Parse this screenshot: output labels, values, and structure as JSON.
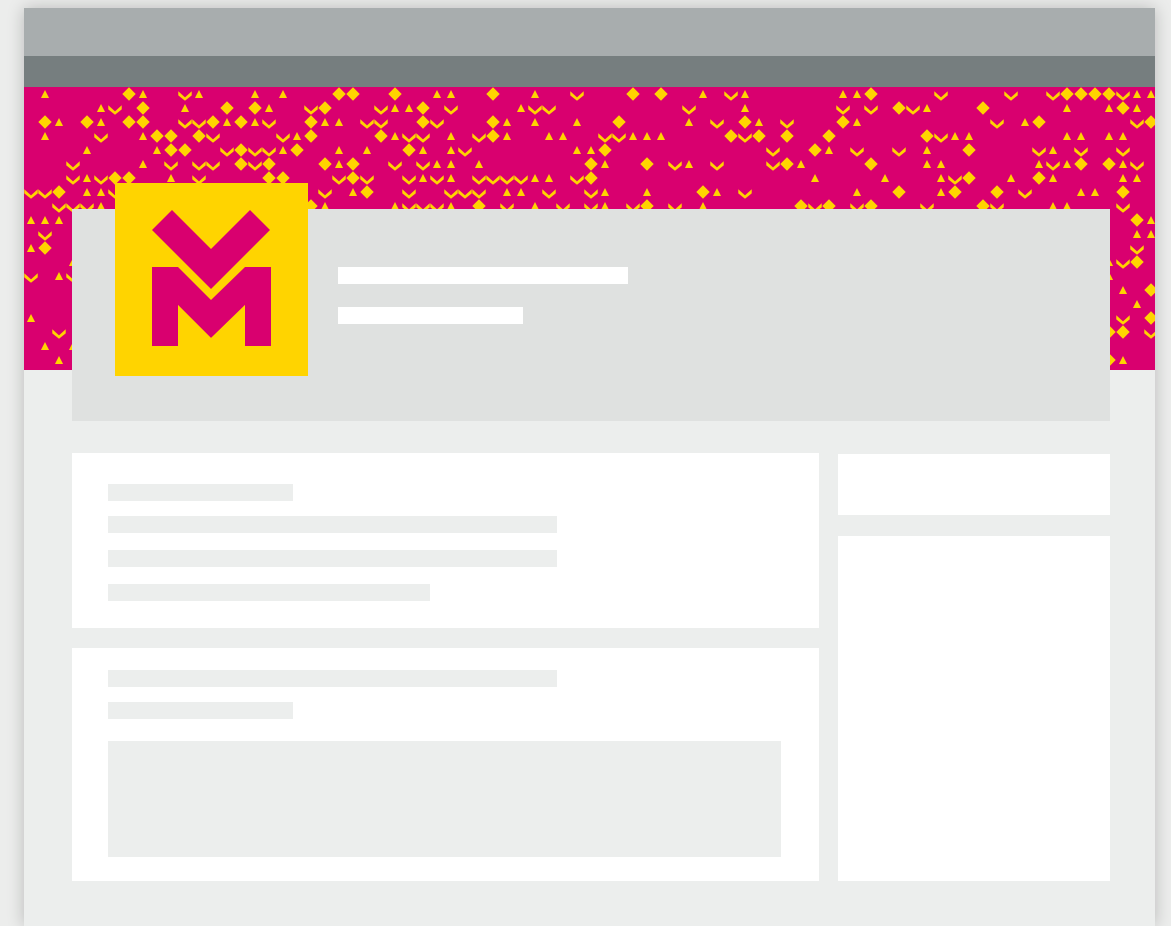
{
  "page": {
    "title": "",
    "colors": {
      "titlebar": "#a8adae",
      "toolbar": "#767e7f",
      "banner_background": "#d9006f",
      "banner_pattern": "#ffd400",
      "logo_background": "#ffd400",
      "logo_mark": "#d9006f",
      "profile_card": "#dfe1e0",
      "page_background": "#eceeed",
      "card": "#ffffff",
      "skeleton": "#eceeed"
    }
  },
  "window": {
    "titlebar_icon": "none",
    "toolbar_icon": "none"
  },
  "profile": {
    "banner_icon": "knit-pattern-icon",
    "logo_icon": "heart-m-logo-icon",
    "name": "",
    "headline": ""
  },
  "main": {
    "cards": [
      {
        "name": "about-card",
        "lines": 4
      },
      {
        "name": "post-card",
        "lines": 2,
        "has_media": true
      }
    ]
  },
  "sidebar": {
    "cards": [
      {
        "name": "sidebar-card-top"
      },
      {
        "name": "sidebar-card-bottom"
      }
    ]
  }
}
